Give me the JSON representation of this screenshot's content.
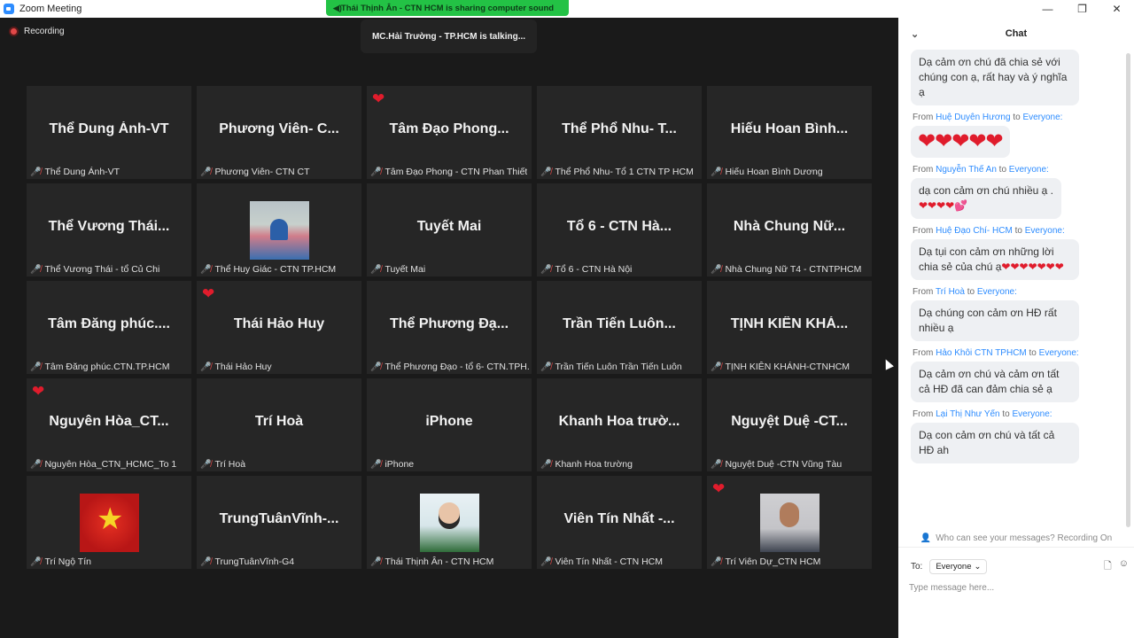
{
  "window": {
    "title": "Zoom Meeting",
    "minimize": "—",
    "maximize": "❐",
    "close": "✕"
  },
  "banner": {
    "sharing_text": "Thái Thịnh Ân - CTN HCM is sharing computer sound"
  },
  "meeting": {
    "recording_label": "Recording",
    "talking_text": "MC.Hải Trường - TP.HCM is talking..."
  },
  "participants": [
    {
      "display": "Thể Dung Ánh-VT",
      "label": "Thể Dung Ánh-VT"
    },
    {
      "display": "Phương Viên- C...",
      "label": "Phương Viên- CTN CT"
    },
    {
      "display": "Tâm Đạo Phong...",
      "label": "Tâm Đạo Phong - CTN Phan Thiết"
    },
    {
      "display": "Thể Phổ Nhu- T...",
      "label": "Thể Phổ Nhu- Tổ 1 CTN TP HCM"
    },
    {
      "display": "Hiếu Hoan Bình...",
      "label": "Hiếu Hoan Bình Dương"
    },
    {
      "display": "Thể Vương Thái...",
      "label": "Thể Vương Thái - tổ Củ Chi"
    },
    {
      "display": "",
      "label": "Thể Huy Giác - CTN TP.HCM"
    },
    {
      "display": "Tuyết Mai",
      "label": "Tuyết Mai"
    },
    {
      "display": "Tổ 6 - CTN Hà...",
      "label": "Tổ 6 - CTN Hà Nội"
    },
    {
      "display": "Nhà Chung Nữ...",
      "label": "Nhà Chung Nữ T4 - CTNTPHCM"
    },
    {
      "display": "Tâm Đăng phúc....",
      "label": "Tâm Đăng phúc.CTN.TP.HCM"
    },
    {
      "display": "Thái Hảo Huy",
      "label": "Thái Hảo Huy"
    },
    {
      "display": "Thể Phương Đạ...",
      "label": "Thể Phương Đạo -  tổ 6- CTN.TPH..."
    },
    {
      "display": "Trần Tiến Luôn...",
      "label": "Trần Tiến Luôn Trần Tiến Luôn"
    },
    {
      "display": "TỊNH KIÊN KHÁ...",
      "label": "TỊNH KIÊN KHÁNH-CTNHCM"
    },
    {
      "display": "Nguyên Hòa_CT...",
      "label": "Nguyên Hòa_CTN_HCMC_To 1"
    },
    {
      "display": "Trí Hoà",
      "label": "Trí Hoà"
    },
    {
      "display": "iPhone",
      "label": "iPhone"
    },
    {
      "display": "Khanh Hoa trườ...",
      "label": "Khanh Hoa trường"
    },
    {
      "display": "Nguyệt Duệ -CT...",
      "label": "Nguyệt Duệ -CTN Vũng Tàu"
    },
    {
      "display": "",
      "label": "Trí Ngộ Tín"
    },
    {
      "display": "TrungTuânVĩnh-...",
      "label": "TrungTuânVĩnh-G4"
    },
    {
      "display": "",
      "label": "Thái Thịnh Ân - CTN HCM"
    },
    {
      "display": "Viên Tín Nhất -...",
      "label": "Viên Tín Nhất - CTN HCM"
    },
    {
      "display": "",
      "label": "Trí Viên Dự_CTN HCM"
    }
  ],
  "reactions": {
    "heart": "❤"
  },
  "chat": {
    "title": "Chat",
    "collapse_icon": "⌄",
    "from_word": "From",
    "to_word": "to",
    "everyone": "Everyone:",
    "messages": [
      {
        "sender": "",
        "text": "Dạ cảm ơn chú đã chia sẻ với chúng con ạ, rất hay và ý nghĩa ạ",
        "hearts": ""
      },
      {
        "sender": "Huệ Duyên Hương",
        "text": "",
        "hearts": "❤❤❤❤❤"
      },
      {
        "sender": "Nguyễn Thế An",
        "text": "dạ con cảm ơn chú nhiều ạ .",
        "hearts": "❤❤❤❤💕"
      },
      {
        "sender": "Huệ Đạo Chí-  HCM",
        "text": "Dạ tụi con cảm ơn những lời chia sẻ của chú ạ",
        "hearts": "❤❤❤❤❤❤❤"
      },
      {
        "sender": "Trí Hoà",
        "text": "Dạ chúng con cảm ơn HĐ rất nhiều ạ",
        "hearts": ""
      },
      {
        "sender": "Hảo Khôi CTN TPHCM",
        "text": "Dạ cảm ơn chú và cảm ơn tất cả HĐ đã can đảm chia sẻ ạ",
        "hearts": ""
      },
      {
        "sender": "Lại Thị Như Yến",
        "text": "Dạ con cảm ơn chú và tất cả HĐ ah",
        "hearts": ""
      }
    ],
    "privacy_text": "Who can see your messages? Recording On",
    "to_label": "To:",
    "to_value": "Everyone",
    "input_placeholder": "Type message here..."
  },
  "colors": {
    "banner_green": "#23c245",
    "link_blue": "#2d8cff",
    "heart_red": "#e01c2c",
    "tile_bg": "#262626"
  }
}
